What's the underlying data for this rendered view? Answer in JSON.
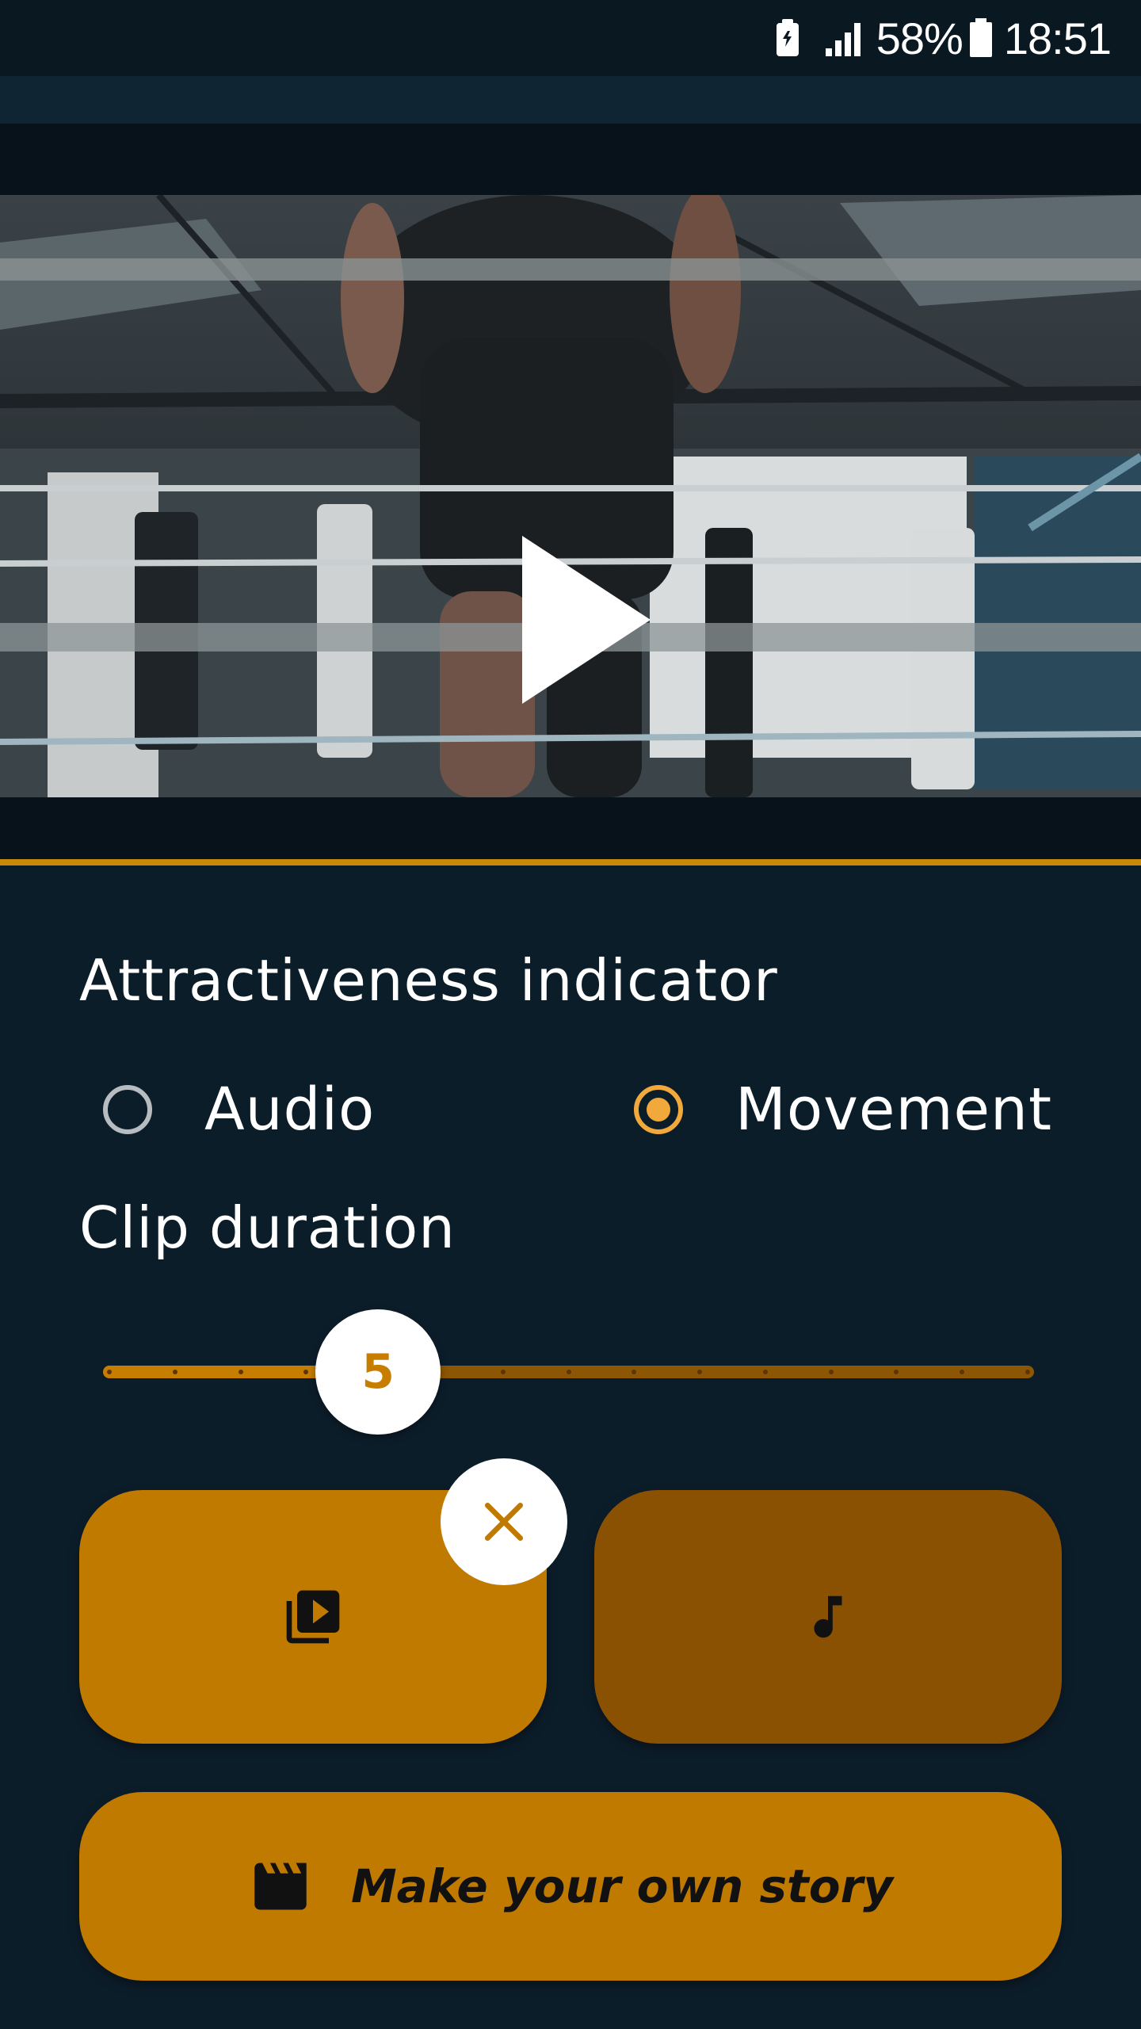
{
  "status_bar": {
    "battery_percent": "58%",
    "time": "18:51"
  },
  "attractiveness": {
    "title": "Attractiveness indicator",
    "options": [
      {
        "label": "Audio",
        "selected": false
      },
      {
        "label": "Movement",
        "selected": true
      }
    ]
  },
  "clip_duration": {
    "title": "Clip duration",
    "value": "5",
    "min": 1,
    "max": 15,
    "steps": 15
  },
  "actions": {
    "story_label": "Make your own story"
  },
  "colors": {
    "background": "#0c1d2a",
    "accent": "#c07a00",
    "accent_dark": "#8a5102",
    "radio_selected": "#f2a93b"
  },
  "icons": {
    "status": [
      "battery-saver-icon",
      "signal-icon",
      "battery-icon"
    ],
    "player": "play-icon",
    "video_button": "video-library-icon",
    "audio_button": "music-note-icon",
    "clear_button": "close-icon",
    "story_button": "clapperboard-icon"
  }
}
